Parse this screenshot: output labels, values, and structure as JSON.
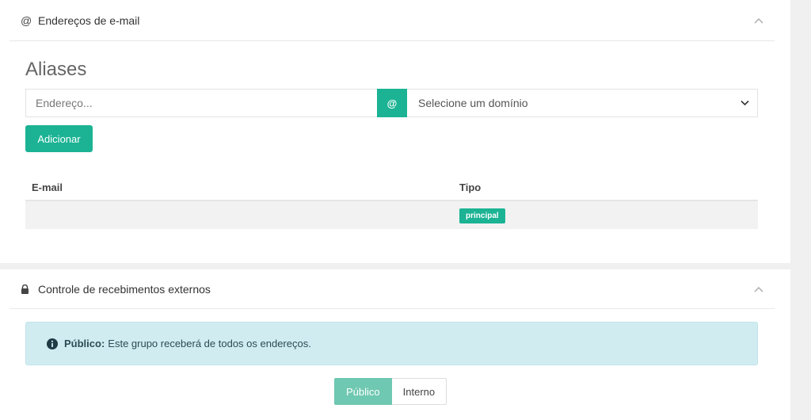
{
  "email_panel": {
    "title": "Endereços de e-mail",
    "header_icon": "at-icon",
    "aliases_title": "Aliases",
    "address_input": {
      "placeholder": "Endereço...",
      "value": ""
    },
    "at_symbol": "@",
    "domain_select": {
      "selected": "Selecione um domínio"
    },
    "add_label": "Adicionar",
    "table": {
      "headers": [
        "E-mail",
        "Tipo"
      ],
      "rows": [
        {
          "email": "",
          "tipo": "principal"
        }
      ]
    }
  },
  "external_panel": {
    "title": "Controle de recebimentos externos",
    "header_icon": "lock-icon",
    "alert": {
      "strong": "Público:",
      "text": "Este grupo receberá de todos os endereços."
    },
    "options": [
      "Público",
      "Interno"
    ],
    "selected_option": "Público"
  },
  "colors": {
    "accent": "#1bb394",
    "accent_light": "#6fc8b1",
    "info_bg": "#d1ecf1"
  }
}
